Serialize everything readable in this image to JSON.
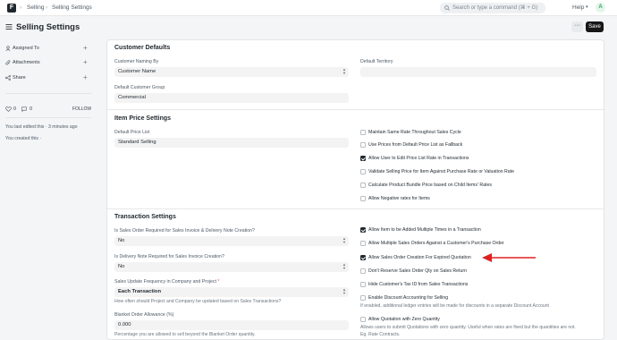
{
  "topbar": {
    "crumb1": "Selling",
    "crumb2": "Selling Settings",
    "search_placeholder": "Search or type a command (⌘ + G)",
    "help": "Help",
    "avatar": "A"
  },
  "page": {
    "title": "Selling Settings",
    "menu": "···",
    "save": "Save"
  },
  "sidebar": {
    "assigned": "Assigned To",
    "attachments": "Attachments",
    "share": "Share",
    "likes": "0",
    "comments": "0",
    "follow": "FOLLOW",
    "edited": "You last edited this · 3 minutes ago",
    "created": "You created this ·"
  },
  "customer": {
    "title": "Customer Defaults",
    "naming_label": "Customer Naming By",
    "naming_value": "Customer Name",
    "group_label": "Default Customer Group",
    "group_value": "Commercial",
    "territory_label": "Default Territory",
    "territory_value": ""
  },
  "item": {
    "title": "Item Price Settings",
    "price_list_label": "Default Price List",
    "price_list_value": "Standard Selling",
    "checks": [
      {
        "label": "Maintain Same Rate Throughout Sales Cycle",
        "checked": false
      },
      {
        "label": "Use Prices from Default Price List as Fallback",
        "checked": false
      },
      {
        "label": "Allow User to Edit Price List Rate in Transactions",
        "checked": true
      },
      {
        "label": "Validate Selling Price for Item Against Purchase Rate or Valuation Rate",
        "checked": false
      },
      {
        "label": "Calculate Product Bundle Price based on Child Items' Rates",
        "checked": false
      },
      {
        "label": "Allow Negative rates for Items",
        "checked": false
      }
    ]
  },
  "transaction": {
    "title": "Transaction Settings",
    "so_label": "Is Sales Order Required for Sales Invoice & Delivery Note Creation?",
    "so_value": "No",
    "dn_label": "Is Delivery Note Required for Sales Invoice Creation?",
    "dn_value": "No",
    "freq_label": "Sales Update Frequency in Company and Project",
    "freq_req": "*",
    "freq_value": "Each Transaction",
    "freq_desc": "How often should Project and Company be updated based on Sales Transactions?",
    "allow_label": "Blanket Order Allowance (%)",
    "allow_value": "0.000",
    "allow_desc": "Percentage you are allowed to sell beyond the Blanket Order quantity.",
    "checks": [
      {
        "label": "Allow Item to be Added Multiple Times in a Transaction",
        "checked": true
      },
      {
        "label": "Allow Multiple Sales Orders Against a Customer's Purchase Order",
        "checked": false
      },
      {
        "label": "Allow Sales Order Creation For Expired Quotation",
        "checked": true
      },
      {
        "label": "Don't Reserve Sales Order Qty on Sales Return",
        "checked": false
      },
      {
        "label": "Hide Customer's Tax ID from Sales Transactions",
        "checked": false
      },
      {
        "label": "Enable Discount Accounting for Selling",
        "checked": false
      },
      {
        "label": "Allow Quotation with Zero Quantity",
        "checked": false
      }
    ],
    "discount_desc": "If enabled, additional ledger entries will be made for discounts in a separate Discount Account",
    "zero_desc1": "Allows users to submit Quotations with zero quantity. Useful when rates are fixed but the quantities are not.",
    "zero_desc2": "Eg. Rate Contracts."
  },
  "colors": {
    "arrow": "#e02020",
    "checked": "#1f272e"
  }
}
